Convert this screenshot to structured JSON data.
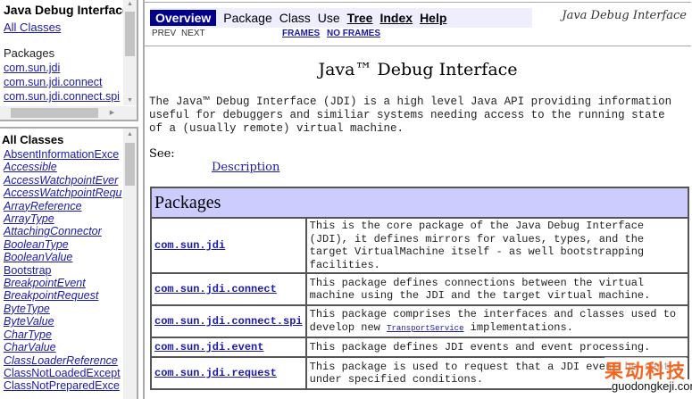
{
  "package_frame": {
    "title": "Java Debug Interface",
    "all_classes_link": "All Classes",
    "packages_heading": "Packages",
    "packages": [
      "com.sun.jdi",
      "com.sun.jdi.connect",
      "com.sun.jdi.connect.spi"
    ]
  },
  "classes_frame": {
    "heading": "All Classes",
    "classes": [
      {
        "name": "AbsentInformationExce",
        "italic": false
      },
      {
        "name": "Accessible",
        "italic": true
      },
      {
        "name": "AccessWatchpointEver",
        "italic": true
      },
      {
        "name": "AccessWatchpointRequ",
        "italic": true
      },
      {
        "name": "ArrayReference",
        "italic": true
      },
      {
        "name": "ArrayType",
        "italic": true
      },
      {
        "name": "AttachingConnector",
        "italic": true
      },
      {
        "name": "BooleanType",
        "italic": true
      },
      {
        "name": "BooleanValue",
        "italic": true
      },
      {
        "name": "Bootstrap",
        "italic": false
      },
      {
        "name": "BreakpointEvent",
        "italic": true
      },
      {
        "name": "BreakpointRequest",
        "italic": true
      },
      {
        "name": "ByteType",
        "italic": true
      },
      {
        "name": "ByteValue",
        "italic": true
      },
      {
        "name": "CharType",
        "italic": true
      },
      {
        "name": "CharValue",
        "italic": true
      },
      {
        "name": "ClassLoaderReference",
        "italic": true
      },
      {
        "name": "ClassNotLoadedExcept",
        "italic": false
      },
      {
        "name": "ClassNotPreparedExce",
        "italic": false
      }
    ]
  },
  "main": {
    "nav": {
      "overview": "Overview",
      "package": "Package",
      "class": "Class",
      "use": "Use",
      "tree": "Tree",
      "index": "Index",
      "help": "Help",
      "prev": "PREV",
      "next": "NEXT",
      "frames": "FRAMES",
      "no_frames": "NO FRAMES",
      "doc_title": "Java Debug Interface"
    },
    "title": "Java™ Debug Interface",
    "intro": "The Java™ Debug Interface (JDI) is a high level Java API providing information useful for debuggers and similiar systems needing access to the running state of a (usually remote) virtual machine.",
    "see_label": "See:",
    "see_link": "Description",
    "packages_heading": "Packages",
    "packages": [
      {
        "name": "com.sun.jdi",
        "desc": "This is the core package of the Java Debug Interface (JDI), it defines mirrors for values, types, and the target VirtualMachine itself - as well bootstrapping facilities."
      },
      {
        "name": "com.sun.jdi.connect",
        "desc": "This package defines connections between the virtual machine using the JDI and the target virtual machine."
      },
      {
        "name": "com.sun.jdi.connect.spi",
        "desc_pre": "This package comprises the interfaces and classes used to develop new ",
        "desc_link": "TransportService",
        "desc_post": " implementations."
      },
      {
        "name": "com.sun.jdi.event",
        "desc": "This package defines JDI events and event processing."
      },
      {
        "name": "com.sun.jdi.request",
        "desc": "This package is used to request that a JDI event be sent under specified conditions."
      }
    ]
  },
  "watermark": {
    "cn": "果动科技",
    "url": "guodongkeji.com",
    "color": "#f26522"
  }
}
